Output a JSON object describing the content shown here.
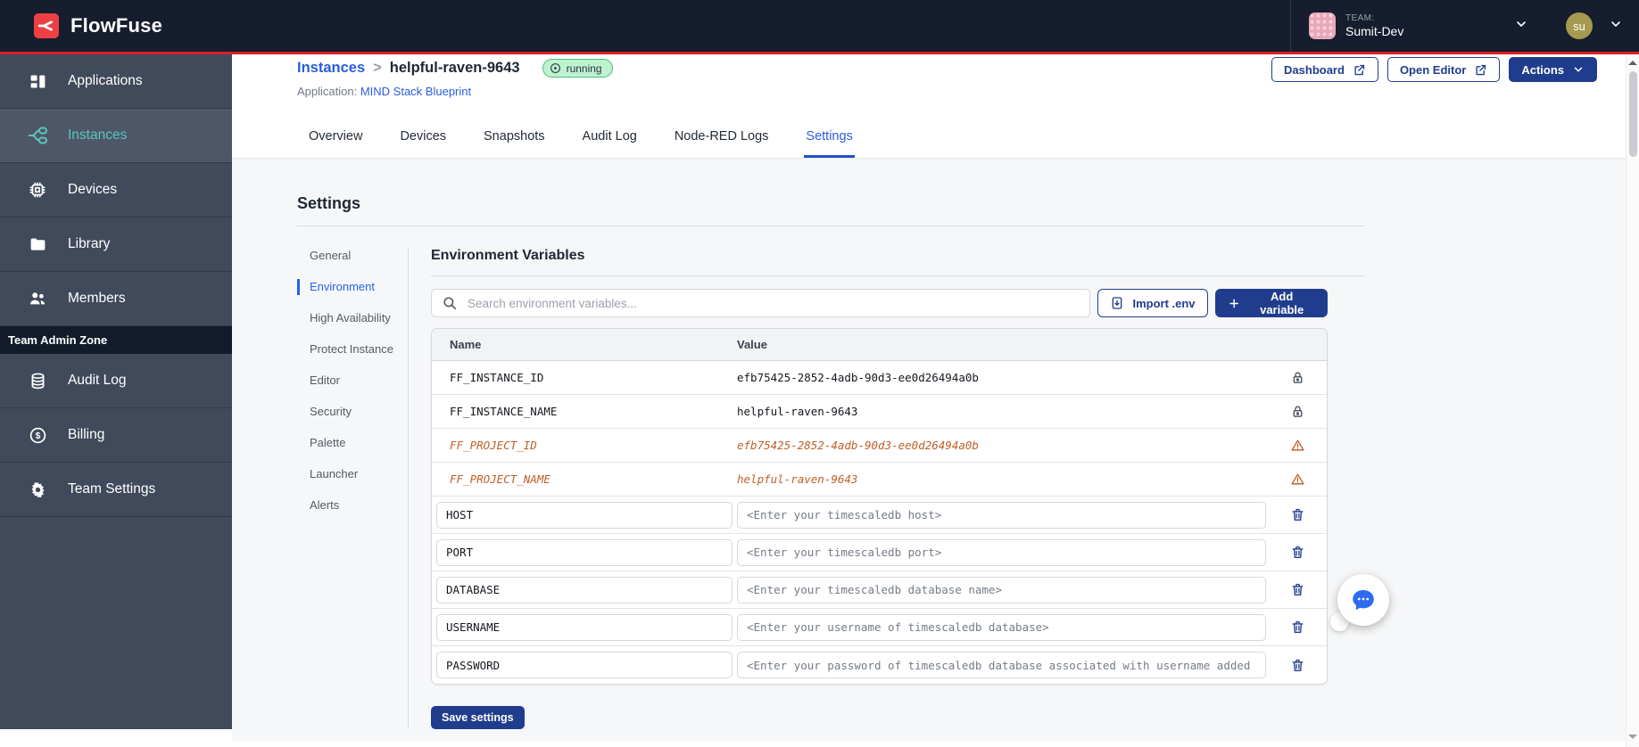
{
  "topbar": {
    "brand": "FlowFuse",
    "team_label": "TEAM:",
    "team_name": "Sumit-Dev",
    "user_initials": "su"
  },
  "sidebar": {
    "items": [
      {
        "label": "Applications"
      },
      {
        "label": "Instances"
      },
      {
        "label": "Devices"
      },
      {
        "label": "Library"
      },
      {
        "label": "Members"
      }
    ],
    "admin_zone_label": "Team Admin Zone",
    "admin_items": [
      {
        "label": "Audit Log"
      },
      {
        "label": "Billing"
      },
      {
        "label": "Team Settings"
      }
    ]
  },
  "header": {
    "breadcrumb_root": "Instances",
    "breadcrumb_sep": ">",
    "instance_name": "helpful-raven-9643",
    "status": "running",
    "application_label": "Application:",
    "application_name": "MIND Stack Blueprint",
    "dashboard_button": "Dashboard",
    "open_editor_button": "Open Editor",
    "actions_button": "Actions"
  },
  "tabs": {
    "items": [
      "Overview",
      "Devices",
      "Snapshots",
      "Audit Log",
      "Node-RED Logs",
      "Settings"
    ],
    "active": "Settings"
  },
  "settings": {
    "title": "Settings",
    "nav": [
      "General",
      "Environment",
      "High Availability",
      "Protect Instance",
      "Editor",
      "Security",
      "Palette",
      "Launcher",
      "Alerts"
    ],
    "active": "Environment"
  },
  "env": {
    "title": "Environment Variables",
    "search_placeholder": "Search environment variables...",
    "import_button": "Import .env",
    "add_button": "Add variable",
    "columns": [
      "Name",
      "Value"
    ],
    "rows": [
      {
        "name": "FF_INSTANCE_ID",
        "value": "efb75425-2852-4adb-90d3-ee0d26494a0b",
        "state": "locked"
      },
      {
        "name": "FF_INSTANCE_NAME",
        "value": "helpful-raven-9643",
        "state": "locked"
      },
      {
        "name": "FF_PROJECT_ID",
        "value": "efb75425-2852-4adb-90d3-ee0d26494a0b",
        "state": "deprecated"
      },
      {
        "name": "FF_PROJECT_NAME",
        "value": "helpful-raven-9643",
        "state": "deprecated"
      },
      {
        "name": "HOST",
        "placeholder": "<Enter your timescaledb host>",
        "state": "editable"
      },
      {
        "name": "PORT",
        "placeholder": "<Enter your timescaledb port>",
        "state": "editable"
      },
      {
        "name": "DATABASE",
        "placeholder": "<Enter your timescaledb database name>",
        "state": "editable"
      },
      {
        "name": "USERNAME",
        "placeholder": "<Enter your username of timescaledb database>",
        "state": "editable"
      },
      {
        "name": "PASSWORD",
        "placeholder": "<Enter your password of timescaledb database associated with username added",
        "state": "editable"
      }
    ],
    "save_button": "Save settings"
  },
  "colors": {
    "accent_red": "#da1f26",
    "navy": "#203d8d",
    "link_blue": "#2a5ddb",
    "sidebar_teal": "#5bc4c0",
    "badge_green_bg": "#bff2d0",
    "badge_green_border": "#4bbd7f",
    "warning_orange": "#bf5e27"
  }
}
